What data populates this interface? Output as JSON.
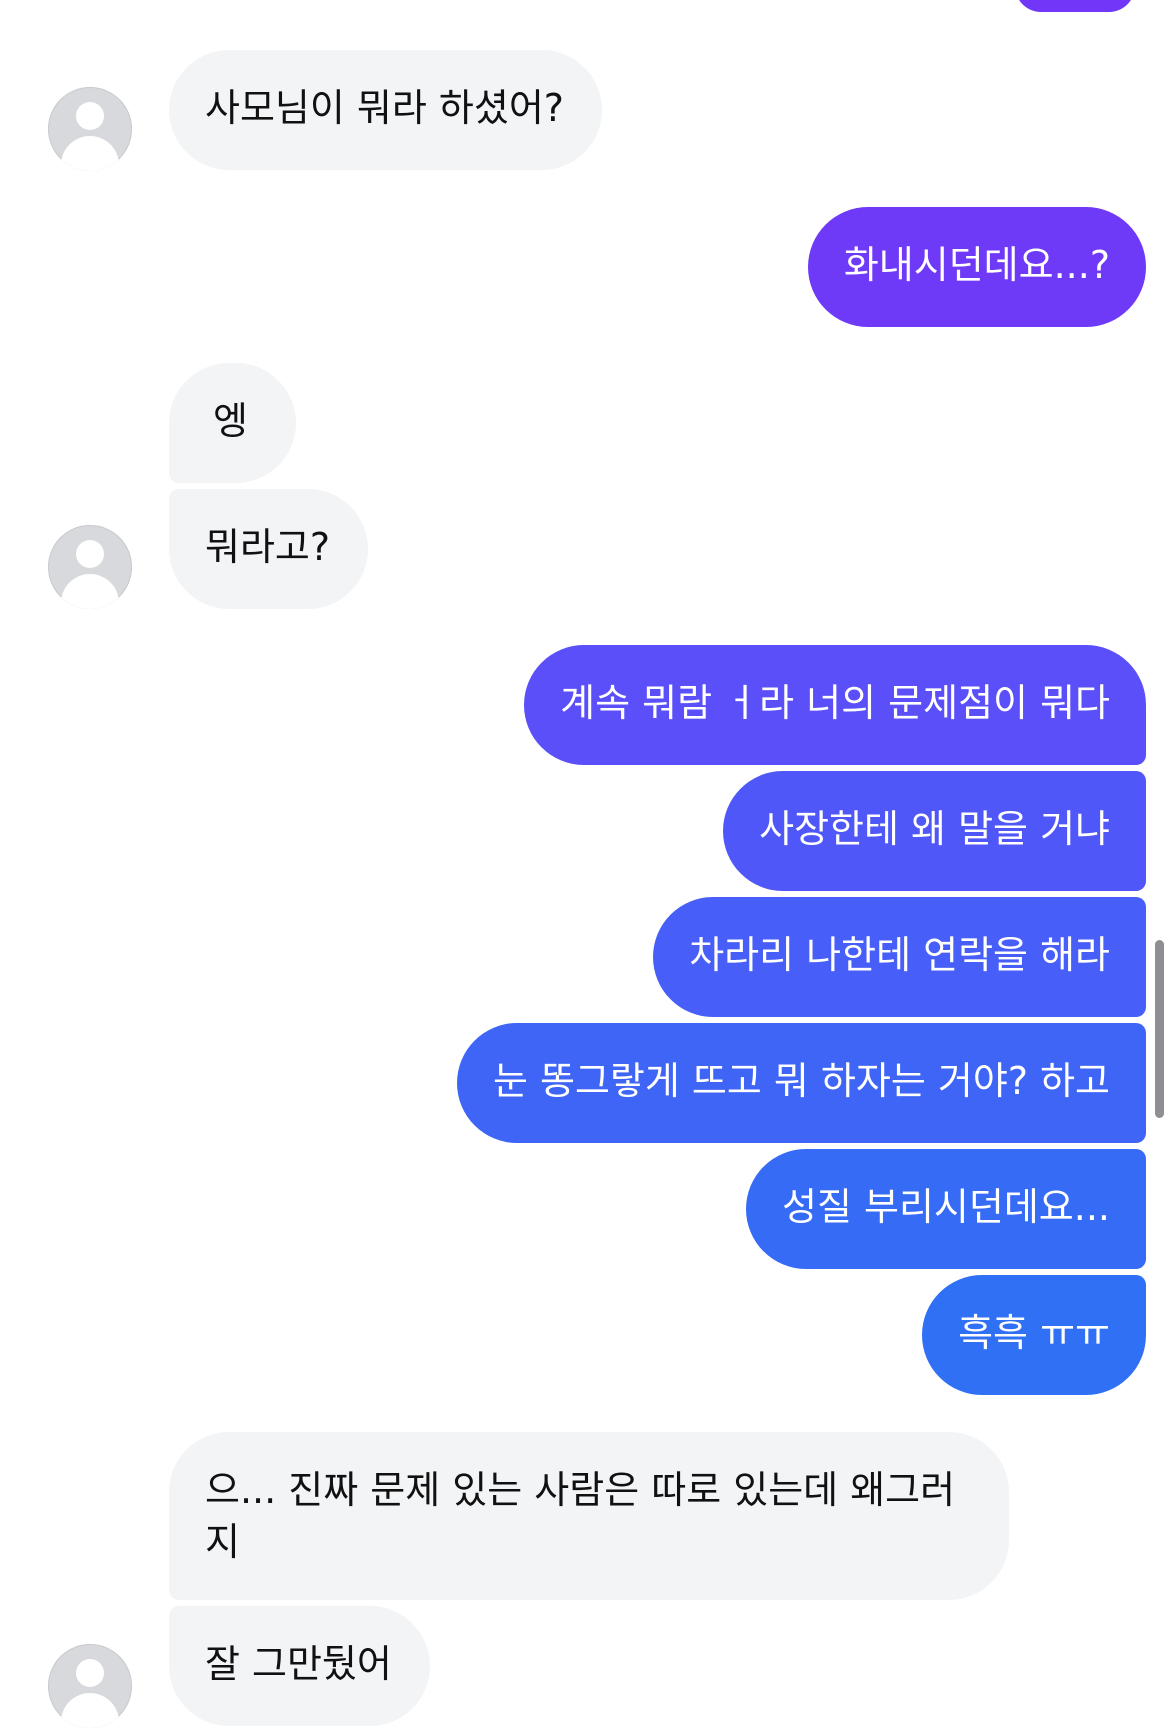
{
  "messages": [
    {
      "side": "in",
      "text": "사모님이 뭐라 하셨어?"
    },
    {
      "side": "out",
      "text": "화내시던데요...?"
    },
    {
      "side": "in",
      "text": "엥"
    },
    {
      "side": "in",
      "text": "뭐라고?"
    },
    {
      "side": "out",
      "text": "계속 뭐람 ㅓ라 너의 문제점이 뭐다"
    },
    {
      "side": "out",
      "text": "사장한테 왜 말을 거냐"
    },
    {
      "side": "out",
      "text": "차라리 나한테 연락을 해라"
    },
    {
      "side": "out",
      "text": "눈 똥그랗게 뜨고 뭐 하자는 거야? 하고"
    },
    {
      "side": "out",
      "text": "성질 부리시던데요..."
    },
    {
      "side": "out",
      "text": "흑흑 ㅠㅠ"
    },
    {
      "side": "in",
      "text": "으... 진짜 문제 있는 사람은 따로 있는데 왜그러지"
    },
    {
      "side": "in",
      "text": "잘 그만뒀어"
    }
  ],
  "colors": {
    "incoming_bubble": "#f3f4f6",
    "outgoing_gradient": [
      "#7136f7",
      "#6b44f8",
      "#5a50f8",
      "#4d58f8",
      "#4561f8",
      "#3c68f7",
      "#336cf6",
      "#2f70f5"
    ],
    "avatar": "#d7d9dc"
  }
}
